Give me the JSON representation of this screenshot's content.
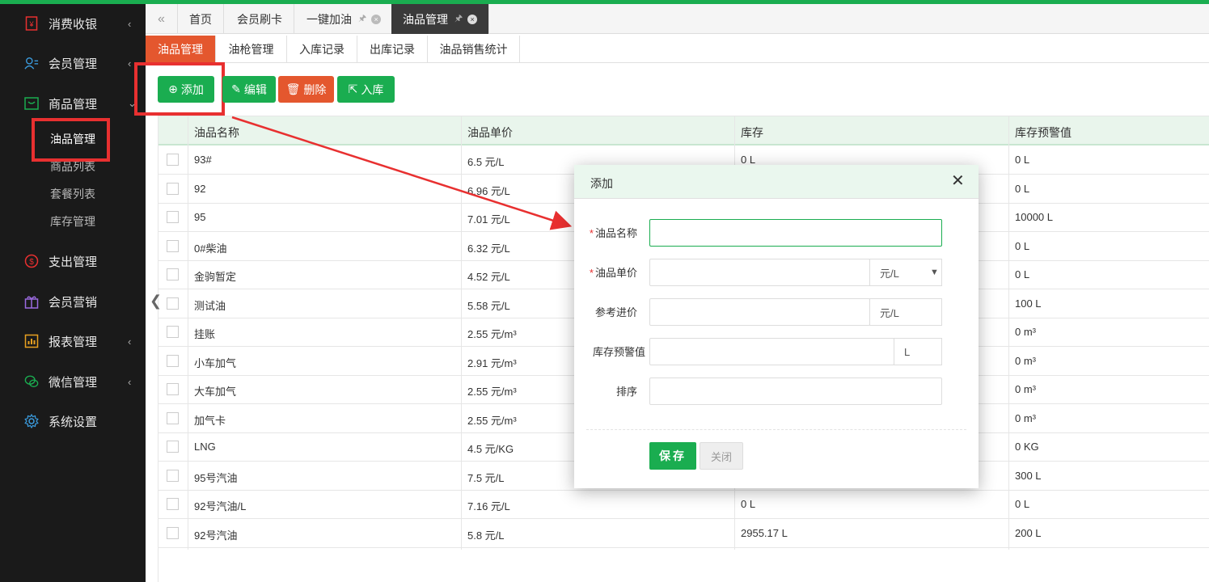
{
  "colors": {
    "accent_green": "#1aad50",
    "accent_orange": "#e4572e",
    "highlight_red": "#e83030",
    "sidebar_bg": "#1a1a1a"
  },
  "sidebar": {
    "items": [
      {
        "label": "消费收银",
        "icon": "cashier-icon"
      },
      {
        "label": "会员管理",
        "icon": "members-icon"
      },
      {
        "label": "商品管理",
        "icon": "goods-icon"
      },
      {
        "label": "支出管理",
        "icon": "expense-icon"
      },
      {
        "label": "会员营销",
        "icon": "gift-icon"
      },
      {
        "label": "报表管理",
        "icon": "report-icon"
      },
      {
        "label": "微信管理",
        "icon": "wechat-icon"
      },
      {
        "label": "系统设置",
        "icon": "settings-icon"
      }
    ],
    "subitems": [
      "油品管理",
      "商品列表",
      "套餐列表",
      "库存管理"
    ]
  },
  "tabs": [
    {
      "label": "首页"
    },
    {
      "label": "会员刷卡"
    },
    {
      "label": "一键加油"
    },
    {
      "label": "油品管理"
    }
  ],
  "subtabs": [
    "油品管理",
    "油枪管理",
    "入库记录",
    "出库记录",
    "油品销售统计"
  ],
  "toolbar": {
    "add": "添加",
    "edit": "编辑",
    "delete": "删除",
    "stock_in": "入库"
  },
  "table": {
    "headers": [
      "油品名称",
      "油品单价",
      "库存",
      "库存预警值"
    ],
    "rows": [
      {
        "name": "93#",
        "price": "6.5 元/L",
        "stock": "0 L",
        "warn": "0 L"
      },
      {
        "name": "92",
        "price": "6.96 元/L",
        "stock": "",
        "warn": "0 L"
      },
      {
        "name": "95",
        "price": "7.01 元/L",
        "stock": "",
        "warn": "10000 L"
      },
      {
        "name": "0#柴油",
        "price": "6.32 元/L",
        "stock": "",
        "warn": "0 L"
      },
      {
        "name": "金驹暂定",
        "price": "4.52 元/L",
        "stock": "",
        "warn": "0 L"
      },
      {
        "name": "测试油",
        "price": "5.58 元/L",
        "stock": "",
        "warn": "100 L"
      },
      {
        "name": "挂账",
        "price": "2.55 元/m³",
        "stock": "",
        "warn": "0 m³"
      },
      {
        "name": "小车加气",
        "price": "2.91 元/m³",
        "stock": "",
        "warn": "0 m³"
      },
      {
        "name": "大车加气",
        "price": "2.55 元/m³",
        "stock": "",
        "warn": "0 m³"
      },
      {
        "name": "加气卡",
        "price": "2.55 元/m³",
        "stock": "",
        "warn": "0 m³"
      },
      {
        "name": "LNG",
        "price": "4.5 元/KG",
        "stock": "",
        "warn": "0 KG"
      },
      {
        "name": "95号汽油",
        "price": "7.5 元/L",
        "stock": "",
        "warn": "300 L"
      },
      {
        "name": "92号汽油/L",
        "price": "7.16 元/L",
        "stock": "0 L",
        "warn": "0 L"
      },
      {
        "name": "92号汽油",
        "price": "5.8 元/L",
        "stock": "2955.17 L",
        "warn": "200 L"
      }
    ]
  },
  "modal": {
    "title": "添加",
    "fields": {
      "name_label": "油品名称",
      "price_label": "油品单价",
      "price_unit": "元/L",
      "ref_label": "参考进价",
      "ref_unit": "元/L",
      "warn_label": "库存预警值",
      "warn_unit": "L",
      "sort_label": "排序"
    },
    "save": "保存",
    "close": "关闭"
  }
}
